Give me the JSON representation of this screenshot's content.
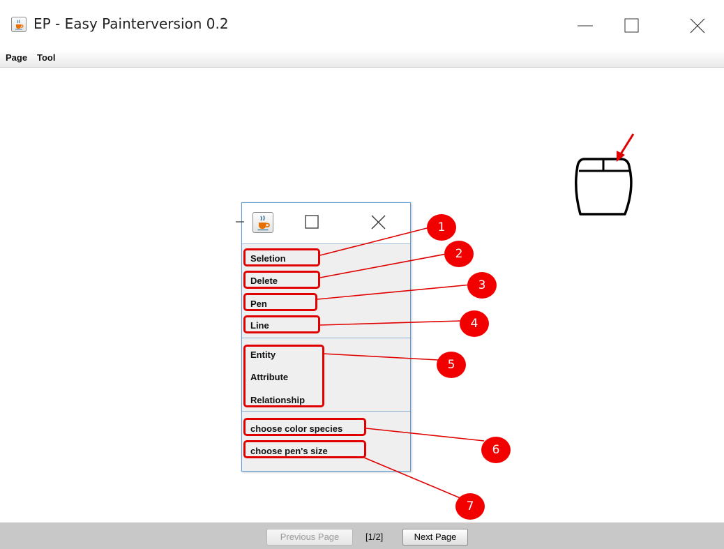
{
  "window": {
    "title": "EP - Easy Painterversion 0.2",
    "controls": {
      "minimize": "—",
      "maximize": "☐",
      "close": "✕"
    }
  },
  "menubar": {
    "items": [
      "Page",
      "Tool"
    ]
  },
  "tool_window": {
    "items": [
      {
        "label": "Seletion",
        "callout": "1"
      },
      {
        "label": "Delete",
        "callout": "2"
      },
      {
        "label": "Pen",
        "callout": "3"
      },
      {
        "label": "Line",
        "callout": "4"
      },
      {
        "label": "Entity",
        "callout": "5"
      },
      {
        "label": "Attribute",
        "callout": "5"
      },
      {
        "label": "Relationship",
        "callout": "5"
      },
      {
        "label": "choose color species",
        "callout": "6"
      },
      {
        "label": "choose pen's size",
        "callout": "7"
      }
    ]
  },
  "callouts": [
    "1",
    "2",
    "3",
    "4",
    "5",
    "6",
    "7"
  ],
  "colors": {
    "highlight": "#e00000",
    "callout_fill": "#f20000",
    "tool_border": "#5b9bd5"
  },
  "pager": {
    "previous_label": "Previous Page",
    "page_indicator": "[1/2]",
    "next_label": "Next Page",
    "previous_enabled": false
  },
  "icons": [
    "java-cup-icon",
    "minimize-icon",
    "maximize-icon",
    "close-icon",
    "mouse-icon",
    "arrow-icon"
  ]
}
